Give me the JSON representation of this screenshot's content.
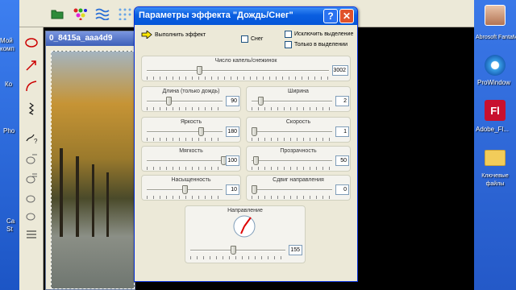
{
  "dialog": {
    "title": "Параметры эффекта \"Дождь/Снег\"",
    "help_label": "?",
    "close_label": "✕",
    "run_label": "Выполнить эффект",
    "snow_label": "Снег",
    "snow_checked": false,
    "exclude_selection_label": "Исключить выделение",
    "exclude_selection_checked": false,
    "only_selection_label": "Только в выделении",
    "only_selection_checked": false,
    "params": {
      "drops": {
        "label": "Число капель/снежинок",
        "value": "3002"
      },
      "length": {
        "label": "Длина (только дождь)",
        "value": "90"
      },
      "width": {
        "label": "Ширина",
        "value": "2"
      },
      "brightness": {
        "label": "Яркость",
        "value": "180"
      },
      "speed": {
        "label": "Скорость",
        "value": "1"
      },
      "softness": {
        "label": "Мягкость",
        "value": "100"
      },
      "transparency": {
        "label": "Прозрачность",
        "value": "50"
      },
      "saturation": {
        "label": "Насыщенность",
        "value": "10"
      },
      "direction_shift": {
        "label": "Сдвиг направления",
        "value": "0"
      },
      "direction": {
        "label": "Направление",
        "value": "155"
      }
    }
  },
  "image_window": {
    "title": "0_8415a_aaa4d9"
  },
  "desktop": {
    "icons": [
      {
        "label": "Abrosoft FantaMor...",
        "icon": "user-photo-icon"
      },
      {
        "label": "ProWindow",
        "icon": "blue-gear-icon"
      },
      {
        "label": "Adobe_Fl...",
        "icon": "flash-icon"
      },
      {
        "label": "Ключевые файлы",
        "icon": "folder-icon"
      }
    ],
    "left_labels": [
      "Мой",
      "комп",
      "Ко",
      "Pho",
      "Ca",
      "St"
    ]
  },
  "colors": {
    "titlebar": "#0a5ee0",
    "dialog_bg": "#ece9d8",
    "workspace": "#000000"
  }
}
